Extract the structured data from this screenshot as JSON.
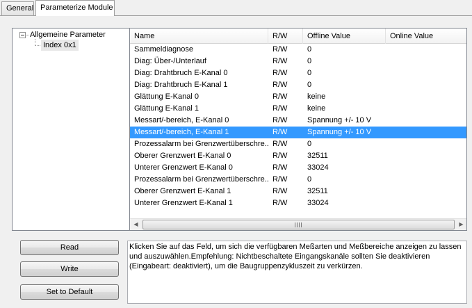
{
  "tabs": [
    {
      "label": "General"
    },
    {
      "label": "Parameterize Module"
    }
  ],
  "tree": {
    "root_label": "Allgemeine Parameter",
    "child_label": "Index 0x1"
  },
  "grid": {
    "columns": [
      "Name",
      "R/W",
      "Offline Value",
      "Online Value"
    ],
    "rows": [
      {
        "name": "Sammeldiagnose",
        "rw": "R/W",
        "offline": "0",
        "online": ""
      },
      {
        "name": "Diag: Über-/Unterlauf",
        "rw": "R/W",
        "offline": "0",
        "online": ""
      },
      {
        "name": "Diag: Drahtbruch E-Kanal 0",
        "rw": "R/W",
        "offline": "0",
        "online": ""
      },
      {
        "name": "Diag: Drahtbruch E-Kanal 1",
        "rw": "R/W",
        "offline": "0",
        "online": ""
      },
      {
        "name": "Glättung E-Kanal 0",
        "rw": "R/W",
        "offline": "keine",
        "online": ""
      },
      {
        "name": "Glättung E-Kanal 1",
        "rw": "R/W",
        "offline": "keine",
        "online": ""
      },
      {
        "name": "Messart/-bereich, E-Kanal 0",
        "rw": "R/W",
        "offline": "Spannung +/- 10 V",
        "online": ""
      },
      {
        "name": "Messart/-bereich, E-Kanal 1",
        "rw": "R/W",
        "offline": "Spannung +/- 10 V",
        "online": "",
        "selected": true
      },
      {
        "name": "Prozessalarm bei Grenzwertüberschre...",
        "rw": "R/W",
        "offline": "0",
        "online": ""
      },
      {
        "name": "Oberer Grenzwert E-Kanal 0",
        "rw": "R/W",
        "offline": "32511",
        "online": ""
      },
      {
        "name": "Unterer Grenzwert E-Kanal 0",
        "rw": "R/W",
        "offline": "33024",
        "online": ""
      },
      {
        "name": "Prozessalarm bei Grenzwertüberschre...",
        "rw": "R/W",
        "offline": "0",
        "online": ""
      },
      {
        "name": "Oberer Grenzwert E-Kanal 1",
        "rw": "R/W",
        "offline": "32511",
        "online": ""
      },
      {
        "name": "Unterer Grenzwert E-Kanal 1",
        "rw": "R/W",
        "offline": "33024",
        "online": ""
      }
    ],
    "scroll_left_glyph": "◀",
    "scroll_right_glyph": "▶"
  },
  "buttons": {
    "read": "Read",
    "write": "Write",
    "set_default": "Set to Default"
  },
  "description": "Klicken Sie auf das Feld, um sich die verfügbaren Meßarten und Meßbereiche anzeigen zu lassen und auszuwählen.Empfehlung: Nichtbeschaltete Eingangskanäle sollten Sie deaktivieren (Eingabeart: deaktiviert), um die Baugruppenzykluszeit zu verkürzen.",
  "colors": {
    "selection": "#3399ff",
    "panel_bg": "#f0f0f0"
  }
}
